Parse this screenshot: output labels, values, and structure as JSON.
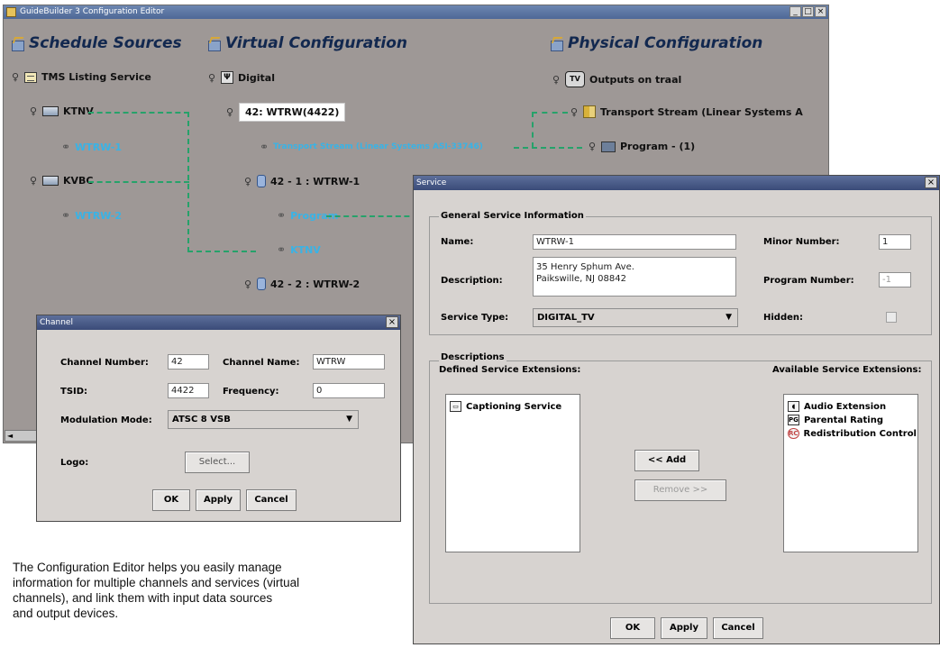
{
  "editor": {
    "title": "GuideBuilder 3 Configuration Editor",
    "window_buttons": [
      "_",
      "□",
      "×"
    ],
    "columns": {
      "schedule": "Schedule Sources",
      "virtual": "Virtual Configuration",
      "physical": "Physical Configuration"
    },
    "schedule_tree": {
      "root": "TMS Listing Service",
      "stations": [
        {
          "name": "KTNV",
          "link": "WTRW-1"
        },
        {
          "name": "KVBC",
          "link": "WTRW-2"
        }
      ]
    },
    "virtual_tree": {
      "root": "Digital",
      "channel": "42: WTRW(4422)",
      "transport_link": "Transport Stream (Linear Systems ASI-33746)",
      "services": [
        {
          "name": "42 - 1 : WTRW-1",
          "links": [
            "Program",
            "KTNV"
          ]
        },
        {
          "name": "42 - 2 : WTRW-2",
          "links": []
        }
      ]
    },
    "physical_tree": {
      "root": "Outputs on traal",
      "transport": "Transport Stream (Linear Systems A",
      "program": "Program - (1)"
    },
    "scroll_arrow": "◄"
  },
  "channel_dialog": {
    "title": "Channel",
    "labels": {
      "number": "Channel Number:",
      "name": "Channel Name:",
      "tsid": "TSID:",
      "frequency": "Frequency:",
      "modulation": "Modulation Mode:",
      "logo": "Logo:"
    },
    "values": {
      "number": "42",
      "name": "WTRW",
      "tsid": "4422",
      "frequency": "0",
      "modulation": "ATSC 8 VSB"
    },
    "buttons": {
      "select": "Select...",
      "ok": "OK",
      "apply": "Apply",
      "cancel": "Cancel"
    }
  },
  "service_dialog": {
    "title": "Service",
    "general_group": "General Service Information",
    "labels": {
      "name": "Name:",
      "description": "Description:",
      "service_type": "Service Type:",
      "minor_number": "Minor Number:",
      "program_number": "Program Number:",
      "hidden": "Hidden:"
    },
    "values": {
      "name": "WTRW-1",
      "description_line1": "35 Henry Sphum Ave.",
      "description_line2": "Paikswille, NJ 08842",
      "service_type": "DIGITAL_TV",
      "minor_number": "1",
      "program_number": "-1"
    },
    "descriptions_group": "Descriptions",
    "defined_label": "Defined Service Extensions:",
    "available_label": "Available Service Extensions:",
    "defined_items": [
      "Captioning Service"
    ],
    "available_items": [
      {
        "icon": "audio-icon",
        "glyph": "◖",
        "label": "Audio Extension"
      },
      {
        "icon": "parental-rating-icon",
        "glyph": "PG",
        "label": "Parental Rating"
      },
      {
        "icon": "redistribution-icon",
        "glyph": "RC",
        "label": "Redistribution Control"
      }
    ],
    "buttons": {
      "add": "<< Add",
      "remove": "Remove >>",
      "ok": "OK",
      "apply": "Apply",
      "cancel": "Cancel"
    }
  },
  "caption": "The Configuration Editor helps you easily manage\n information for multiple channels and services (virtual\nchannels), and link them with input data sources\nand output devices."
}
